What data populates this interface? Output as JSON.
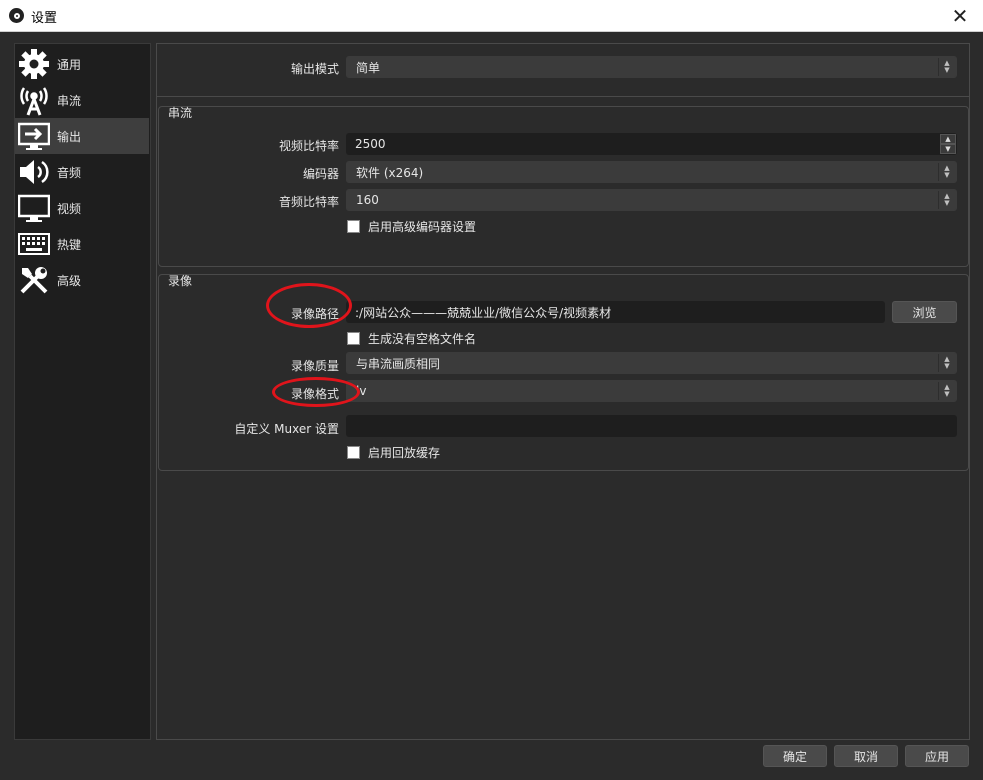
{
  "window": {
    "title": "设置",
    "close_glyph": "✕"
  },
  "sidebar": {
    "items": [
      {
        "label": "通用",
        "icon": "gear-icon"
      },
      {
        "label": "串流",
        "icon": "antenna-icon"
      },
      {
        "label": "输出",
        "icon": "output-monitor-icon"
      },
      {
        "label": "音频",
        "icon": "speaker-icon"
      },
      {
        "label": "视频",
        "icon": "monitor-icon"
      },
      {
        "label": "热键",
        "icon": "keyboard-icon"
      },
      {
        "label": "高级",
        "icon": "tools-icon"
      }
    ],
    "active": "输出"
  },
  "output_mode": {
    "label": "输出模式",
    "value": "简单"
  },
  "streaming": {
    "title": "串流",
    "video_bitrate": {
      "label": "视频比特率",
      "value": "2500"
    },
    "encoder": {
      "label": "编码器",
      "value": "软件 (x264)"
    },
    "audio_bitrate": {
      "label": "音频比特率",
      "value": "160"
    },
    "advanced_encoder": {
      "label": "启用高级编码器设置",
      "checked": false
    }
  },
  "recording": {
    "title": "录像",
    "path": {
      "label": "录像路径",
      "value": ":/网站公众———兢兢业业/微信公众号/视频素材",
      "browse": "浏览"
    },
    "no_space": {
      "label": "生成没有空格文件名",
      "checked": false
    },
    "quality": {
      "label": "录像质量",
      "value": "与串流画质相同"
    },
    "format": {
      "label": "录像格式",
      "value": "lv"
    },
    "muxer": {
      "label": "自定义 Muxer 设置",
      "value": ""
    },
    "replay_buffer": {
      "label": "启用回放缓存",
      "checked": false
    }
  },
  "footer": {
    "ok": "确定",
    "cancel": "取消",
    "apply": "应用"
  },
  "colors": {
    "accent": "#e0141b",
    "background": "#2b2b2b",
    "sidebar": "#1e1e1e"
  }
}
